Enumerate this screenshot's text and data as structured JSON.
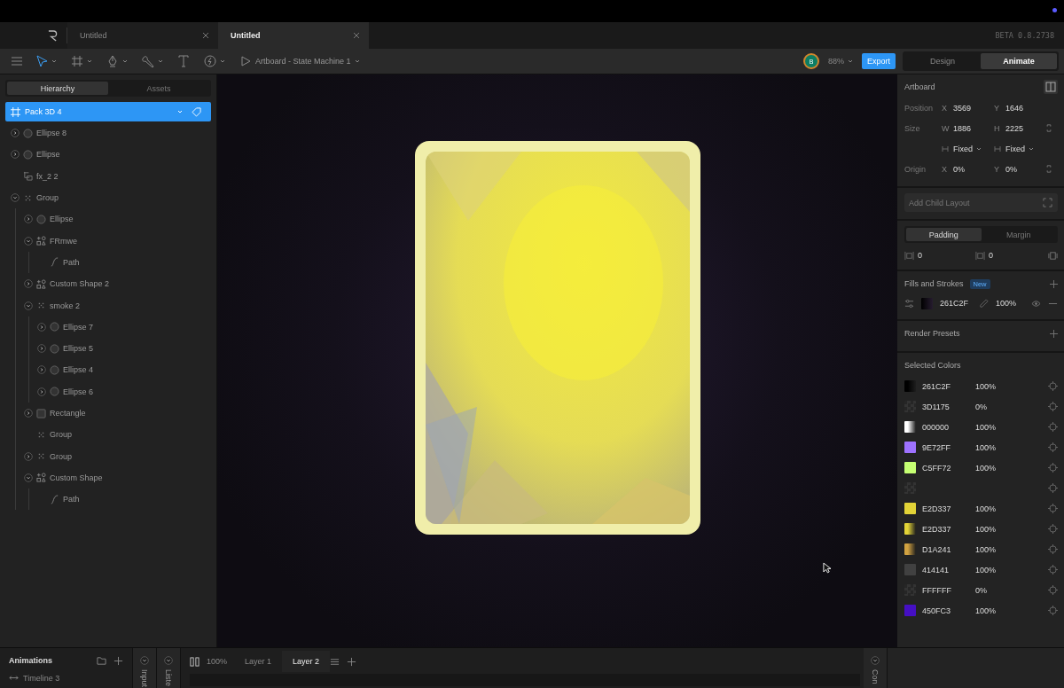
{
  "tabs": [
    {
      "label": "Untitled",
      "selected": false
    },
    {
      "label": "Untitled",
      "selected": true
    }
  ],
  "version": "BETA 0.8.2738",
  "toolbar": {
    "breadcrumb": "Artboard - State Machine 1",
    "avatar": "B",
    "zoom": "88%",
    "export": "Export",
    "modes": [
      {
        "label": "Design",
        "selected": false
      },
      {
        "label": "Animate",
        "selected": true
      }
    ]
  },
  "hierarchy": {
    "tabs": [
      {
        "label": "Hierarchy",
        "selected": true
      },
      {
        "label": "Assets",
        "selected": false
      }
    ],
    "root": {
      "label": "Pack 3D 4",
      "selected": true
    },
    "items": [
      {
        "label": "Ellipse 8",
        "kind": "ellipse",
        "expanded": false
      },
      {
        "label": "Ellipse",
        "kind": "ellipse",
        "expanded": false
      },
      {
        "label": "fx_2 2",
        "kind": "frame"
      },
      {
        "label": "Group",
        "kind": "group",
        "expanded": true,
        "children": [
          {
            "label": "Ellipse",
            "kind": "ellipse",
            "expanded": false
          },
          {
            "label": "FRmwe",
            "kind": "shape",
            "expanded": true,
            "children": [
              {
                "label": "Path",
                "kind": "path"
              }
            ]
          },
          {
            "label": "Custom Shape 2",
            "kind": "shape",
            "expanded": false
          },
          {
            "label": "smoke 2",
            "kind": "group",
            "expanded": true,
            "children": [
              {
                "label": "Ellipse 7",
                "kind": "ellipse",
                "expanded": false
              },
              {
                "label": "Ellipse 5",
                "kind": "ellipse",
                "expanded": false
              },
              {
                "label": "Ellipse 4",
                "kind": "ellipse",
                "expanded": false
              },
              {
                "label": "Ellipse 6",
                "kind": "ellipse",
                "expanded": false
              }
            ]
          },
          {
            "label": "Rectangle",
            "kind": "rect",
            "expanded": false
          },
          {
            "label": "Group",
            "kind": "group"
          },
          {
            "label": "Group",
            "kind": "group",
            "expanded": false
          },
          {
            "label": "Custom Shape",
            "kind": "shape",
            "expanded": true,
            "children": [
              {
                "label": "Path",
                "kind": "path"
              }
            ]
          }
        ]
      }
    ]
  },
  "inspector": {
    "title": "Artboard",
    "rows": [
      {
        "label": "Position",
        "fields": [
          {
            "axis": "X",
            "value": "3569"
          },
          {
            "axis": "Y",
            "value": "1646"
          }
        ]
      },
      {
        "label": "Size",
        "fields": [
          {
            "axis": "W",
            "value": "1886"
          },
          {
            "axis": "H",
            "value": "2225"
          }
        ]
      },
      {
        "fields": [
          {
            "value": "Fixed"
          },
          {
            "value": "Fixed"
          }
        ]
      },
      {
        "label": "Origin",
        "fields": [
          {
            "axis": "X",
            "value": "0%"
          },
          {
            "axis": "Y",
            "value": "0%"
          }
        ]
      }
    ],
    "child_layout": {
      "placeholder": "Add Child Layout"
    },
    "spacing_tabs": [
      {
        "label": "Padding",
        "selected": true
      },
      {
        "label": "Margin",
        "selected": false
      }
    ],
    "spacing_values": [
      "0",
      "0"
    ],
    "fills_title": "Fills and Strokes",
    "fills_badge": "New",
    "fill": {
      "hex": "261C2F",
      "opacity": "100%"
    },
    "render_presets": "Render Presets",
    "colors_title": "Selected Colors",
    "colors": [
      {
        "kind": "gradient",
        "color": "#000000",
        "hex": "261C2F",
        "opacity": "100%"
      },
      {
        "kind": "checker",
        "hex": "3D1175",
        "opacity": "0%"
      },
      {
        "kind": "gradient",
        "color": "#ffffff",
        "hex": "000000",
        "opacity": "100%"
      },
      {
        "kind": "solid",
        "color": "#9e72ff",
        "hex": "9E72FF",
        "opacity": "100%"
      },
      {
        "kind": "solid",
        "color": "#c5ff72",
        "hex": "C5FF72",
        "opacity": "100%"
      },
      {
        "kind": "checker"
      },
      {
        "kind": "solid",
        "color": "#e2d337",
        "hex": "E2D337",
        "opacity": "100%"
      },
      {
        "kind": "gradient",
        "color": "#e2d337",
        "hex": "E2D337",
        "opacity": "100%"
      },
      {
        "kind": "gradient",
        "color": "#d1a241",
        "hex": "D1A241",
        "opacity": "100%"
      },
      {
        "kind": "solid",
        "color": "#414141",
        "hex": "414141",
        "opacity": "100%"
      },
      {
        "kind": "checker",
        "hex": "FFFFFF",
        "opacity": "0%"
      },
      {
        "kind": "solid",
        "color": "#450fc3",
        "hex": "450FC3",
        "opacity": "100%"
      }
    ]
  },
  "bottom": {
    "title": "Animations",
    "timeline": "Timeline 3",
    "panels": [
      "Input",
      "Liste",
      "Con"
    ],
    "zoom": "100%",
    "layers": [
      {
        "label": "Layer 1",
        "selected": false
      },
      {
        "label": "Layer 2",
        "selected": true
      }
    ]
  }
}
